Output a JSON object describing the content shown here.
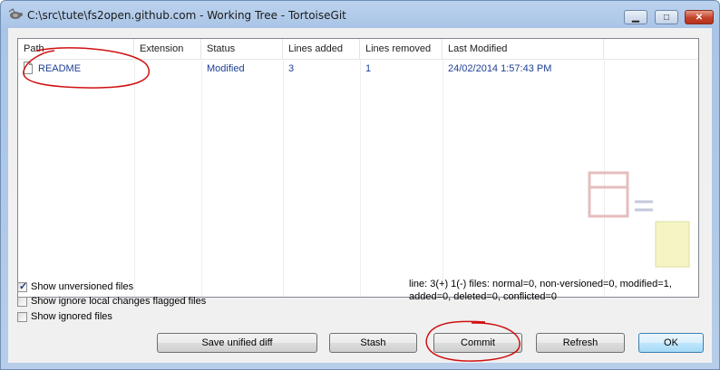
{
  "window": {
    "title": "C:\\src\\tute\\fs2open.github.com - Working Tree - TortoiseGit",
    "controls": {
      "minimize": "▁",
      "maximize": "□",
      "close": "✕"
    }
  },
  "file_list": {
    "columns": [
      "Path",
      "Extension",
      "Status",
      "Lines added",
      "Lines removed",
      "Last Modified"
    ],
    "rows": [
      {
        "path": "README",
        "extension": "",
        "status": "Modified",
        "lines_added": "3",
        "lines_removed": "1",
        "last_modified": "24/02/2014 1:57:43 PM"
      }
    ]
  },
  "options": {
    "show_unversioned": {
      "label": "Show unversioned files",
      "checked": true
    },
    "show_ignore_local": {
      "label": "Show ignore local changes flagged files",
      "checked": false
    },
    "show_ignored": {
      "label": "Show ignored files",
      "checked": false
    }
  },
  "status_text": {
    "line1": "line: 3(+) 1(-) files: normal=0, non-versioned=0, modified=1,",
    "line2": "added=0, deleted=0, conflicted=0"
  },
  "buttons": {
    "save_diff": "Save unified diff",
    "stash": "Stash",
    "commit": "Commit",
    "refresh": "Refresh",
    "ok": "OK"
  },
  "colors": {
    "list_text": "#1c3f94",
    "annotation": "#d01010"
  }
}
